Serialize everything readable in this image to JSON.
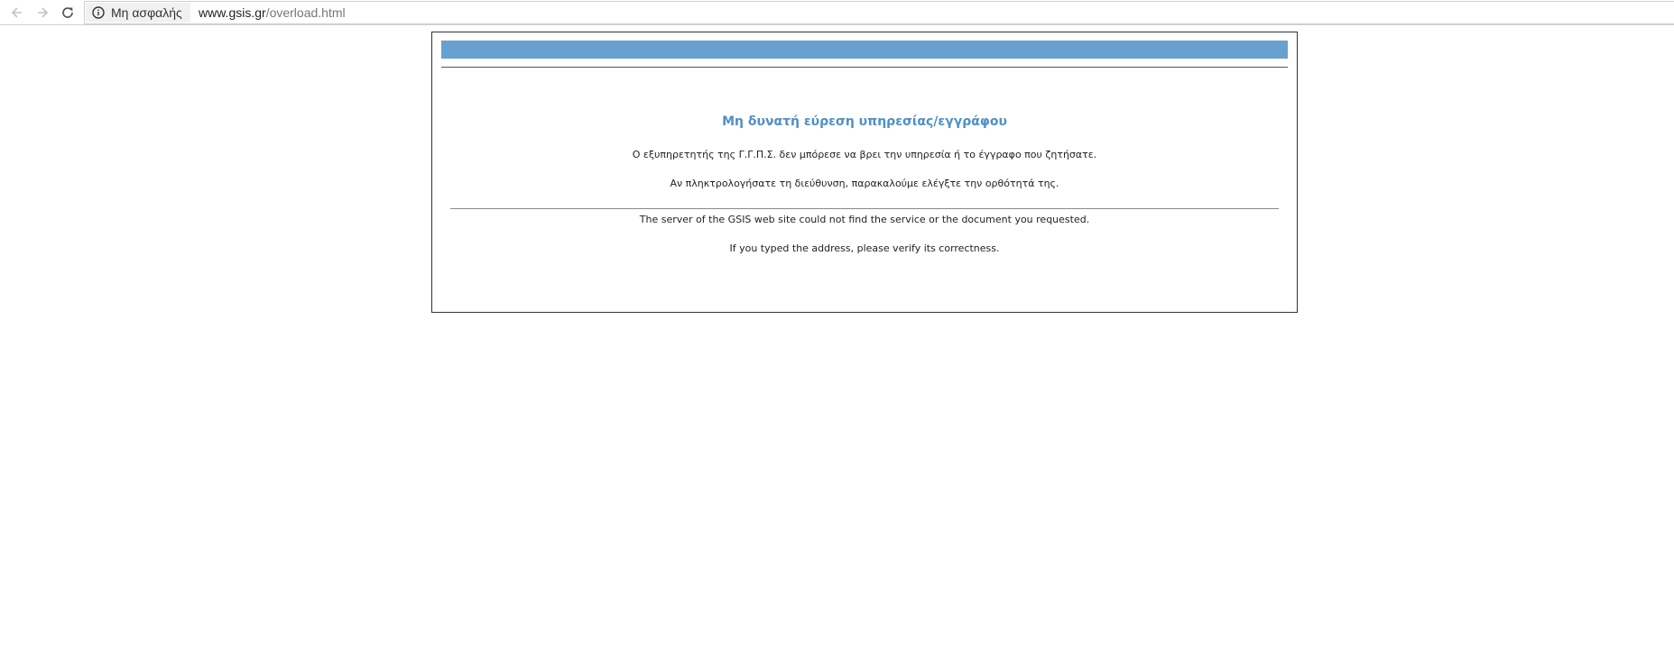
{
  "browser": {
    "security_label": "Μη ασφαλής",
    "url_host": "www.gsis.gr",
    "url_path": "/overload.html"
  },
  "page": {
    "heading": "Μη δυνατή εύρεση υπηρεσίας/εγγράφου",
    "greek_message_1": "Ο εξυπηρετητής της Γ.Γ.Π.Σ. δεν μπόρεσε να βρει την υπηρεσία ή το έγγραφο που ζητήσατε.",
    "greek_message_2": "Αν πληκτρολογήσατε τη διεύθυνση, παρακαλούμε ελέγξτε την ορθότητά της.",
    "english_message_1": "The server of the GSIS web site could not find the service or the document you requested.",
    "english_message_2": "If you typed the address, please verify its correctness."
  },
  "colors": {
    "banner": "#68a0cf",
    "heading": "#4f8fc7"
  },
  "icons": {
    "back": "arrow-left-icon",
    "forward": "arrow-right-icon",
    "reload": "reload-icon",
    "security": "info-circle-icon"
  }
}
